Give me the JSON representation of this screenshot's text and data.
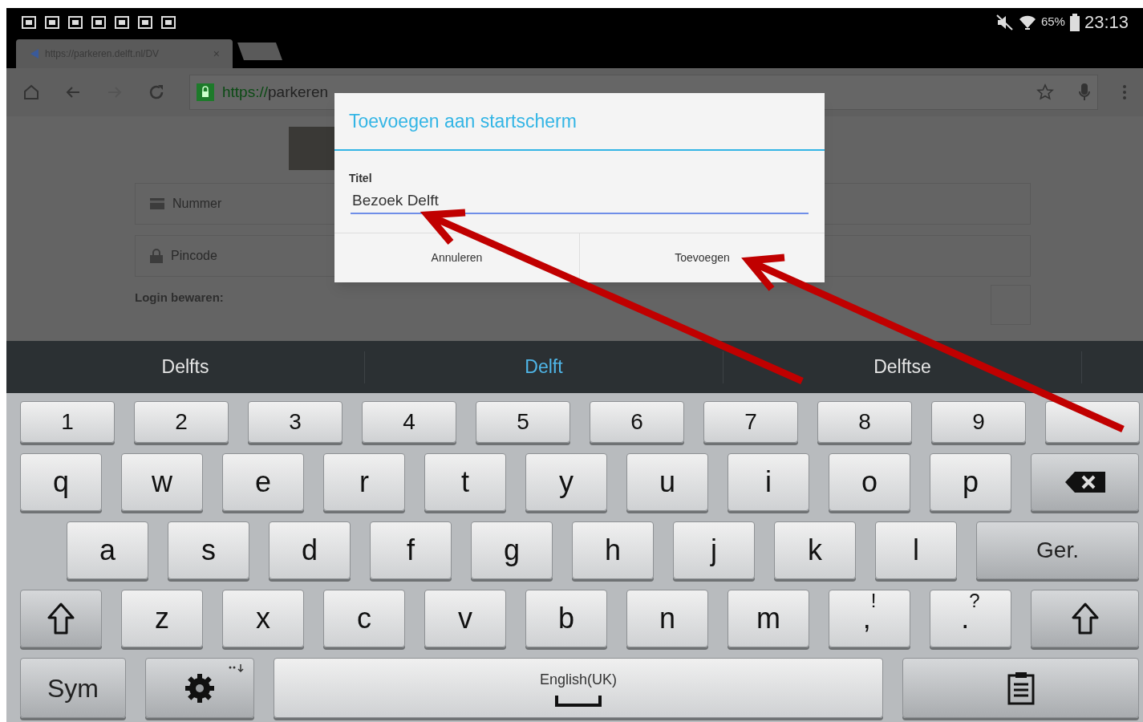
{
  "status_bar": {
    "battery_percent": "65%",
    "time": "23:13"
  },
  "browser": {
    "tab": {
      "title": "https://parkeren.delft.nl/DV",
      "close": "×"
    },
    "url": {
      "scheme": "https://",
      "host": "parkeren"
    },
    "forward_disabled": true
  },
  "page": {
    "fields": [
      {
        "kind": "card",
        "placeholder": "Nummer"
      },
      {
        "kind": "lock",
        "placeholder": "Pincode"
      }
    ],
    "remember_label": "Login bewaren:",
    "remember_checked": false
  },
  "dialog": {
    "title": "Toevoegen aan startscherm",
    "field_label": "Titel",
    "field_value": "Bezoek Delft",
    "buttons": [
      "Annuleren",
      "Toevoegen"
    ]
  },
  "suggestions": [
    {
      "text": "Delfts",
      "selected": false
    },
    {
      "text": "Delft",
      "selected": true
    },
    {
      "text": "Delftse",
      "selected": false
    }
  ],
  "keyboard": {
    "rows": [
      {
        "keys": [
          {
            "kind": "char",
            "label": "1"
          },
          {
            "kind": "char",
            "label": "2"
          },
          {
            "kind": "char",
            "label": "3"
          },
          {
            "kind": "char",
            "label": "4"
          },
          {
            "kind": "char",
            "label": "5"
          },
          {
            "kind": "char",
            "label": "6"
          },
          {
            "kind": "char",
            "label": "7"
          },
          {
            "kind": "char",
            "label": "8"
          },
          {
            "kind": "char",
            "label": "9"
          },
          {
            "kind": "char"
          }
        ]
      },
      {
        "keys": [
          {
            "kind": "char",
            "label": "q"
          },
          {
            "kind": "char",
            "label": "w"
          },
          {
            "kind": "char",
            "label": "e"
          },
          {
            "kind": "char",
            "label": "r"
          },
          {
            "kind": "char",
            "label": "t"
          },
          {
            "kind": "char",
            "label": "y"
          },
          {
            "kind": "char",
            "label": "u"
          },
          {
            "kind": "char",
            "label": "i"
          },
          {
            "kind": "char",
            "label": "o"
          },
          {
            "kind": "char",
            "label": "p"
          },
          {
            "kind": "backspace"
          }
        ]
      },
      {
        "keys": [
          {
            "kind": "char",
            "label": "a"
          },
          {
            "kind": "char",
            "label": "s"
          },
          {
            "kind": "char",
            "label": "d"
          },
          {
            "kind": "char",
            "label": "f"
          },
          {
            "kind": "char",
            "label": "g"
          },
          {
            "kind": "char",
            "label": "h"
          },
          {
            "kind": "char",
            "label": "j"
          },
          {
            "kind": "char",
            "label": "k"
          },
          {
            "kind": "char",
            "label": "l"
          },
          {
            "kind": "enter",
            "label": "Ger."
          }
        ]
      },
      {
        "keys": [
          {
            "kind": "shift"
          },
          {
            "kind": "char",
            "label": "z"
          },
          {
            "kind": "char",
            "label": "x"
          },
          {
            "kind": "char",
            "label": "c"
          },
          {
            "kind": "char",
            "label": "v"
          },
          {
            "kind": "char",
            "label": "b"
          },
          {
            "kind": "char",
            "label": "n"
          },
          {
            "kind": "char",
            "label": "m"
          },
          {
            "kind": "punct",
            "label": ",",
            "alt": "!"
          },
          {
            "kind": "punct",
            "label": ".",
            "alt": "?"
          },
          {
            "kind": "shift"
          }
        ]
      },
      {
        "keys": [
          {
            "kind": "sym",
            "label": "Sym"
          },
          {
            "kind": "settings"
          },
          {
            "kind": "space",
            "label": "English(UK)"
          },
          {
            "kind": "clipboard"
          }
        ]
      }
    ]
  }
}
